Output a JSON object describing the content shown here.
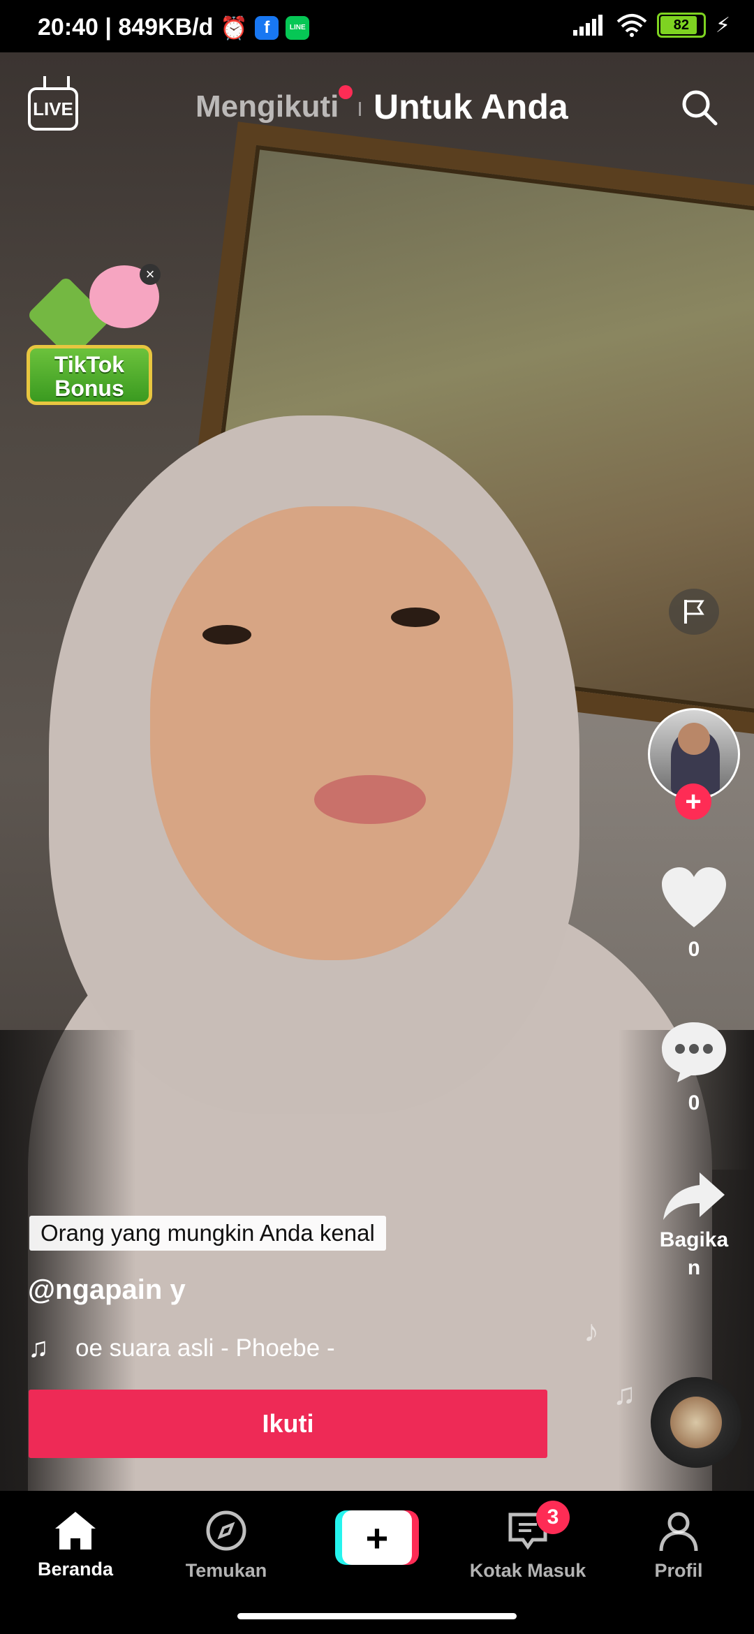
{
  "status_bar": {
    "time_speed": "20:40 | 849KB/d",
    "battery": "82",
    "icons": [
      "alarm-icon",
      "facebook-icon",
      "line-today-icon",
      "signal-icon",
      "wifi-icon",
      "battery-icon",
      "charging-icon"
    ]
  },
  "top_nav": {
    "live_label": "LIVE",
    "tab_following": "Mengikuti",
    "tab_for_you": "Untuk Anda",
    "accent": "#fe2c55"
  },
  "bonus": {
    "title_line1": "TikTok",
    "title_line2": "Bonus",
    "close": "×"
  },
  "rail": {
    "likes": "0",
    "comments": "0",
    "share_label": "Bagikan"
  },
  "post": {
    "people_tag": "Orang yang mungkin Anda kenal",
    "username": "@ngapain y",
    "music": "oe    suara asli - Phoebe -",
    "follow_button": "Ikuti"
  },
  "bottom_nav": {
    "home": "Beranda",
    "discover": "Temukan",
    "create": "+",
    "inbox": "Kotak Masuk",
    "inbox_badge": "3",
    "profile": "Profil"
  }
}
